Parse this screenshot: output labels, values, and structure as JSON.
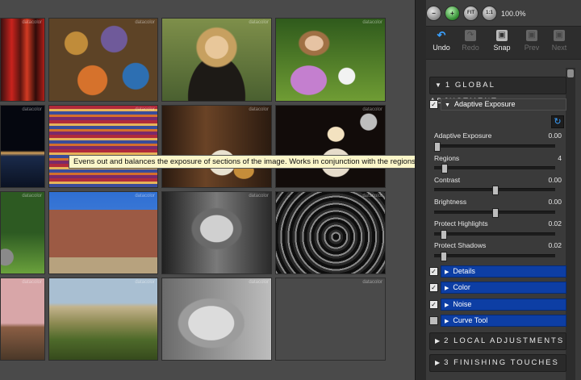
{
  "tooltip": "Evens out and balances the exposure of sections of the image. Works in conjunction with the regions slider",
  "watermark": "datacolor",
  "zoom": {
    "buttons": [
      "−",
      "+",
      "FIT",
      "1:1"
    ],
    "value": "100.0%"
  },
  "toolbar": {
    "buttons": [
      {
        "label": "Undo",
        "enabled": true
      },
      {
        "label": "Redo",
        "enabled": false
      },
      {
        "label": "Snap",
        "enabled": true
      },
      {
        "label": "Prev",
        "enabled": false
      },
      {
        "label": "Next",
        "enabled": false
      }
    ]
  },
  "sections": {
    "global": "1 GLOBAL ADJUSTMENT",
    "local": "2 LOCAL ADJUSTMENTS",
    "finishing": "3 FINISHING TOUCHES"
  },
  "adaptive": {
    "header": "Adaptive Exposure",
    "sliders": [
      {
        "label": "Adaptive Exposure",
        "value": "0.00",
        "fraction": 0.02
      },
      {
        "label": "Regions",
        "value": "4",
        "fraction": 0.08
      },
      {
        "label": "Contrast",
        "value": "0.00",
        "fraction": 0.5
      },
      {
        "label": "Brightness",
        "value": "0.00",
        "fraction": 0.5
      },
      {
        "label": "Protect Highlights",
        "value": "0.02",
        "fraction": 0.07
      },
      {
        "label": "Protect Shadows",
        "value": "0.02",
        "fraction": 0.07
      }
    ]
  },
  "subsections": [
    {
      "label": "Details",
      "checked": true
    },
    {
      "label": "Color",
      "checked": true
    },
    {
      "label": "Noise",
      "checked": true
    },
    {
      "label": "Curve Tool",
      "checked": false
    }
  ],
  "colors": {
    "accent_blue": "#0d3ea4",
    "tooltip_bg": "#fbf6c9"
  }
}
